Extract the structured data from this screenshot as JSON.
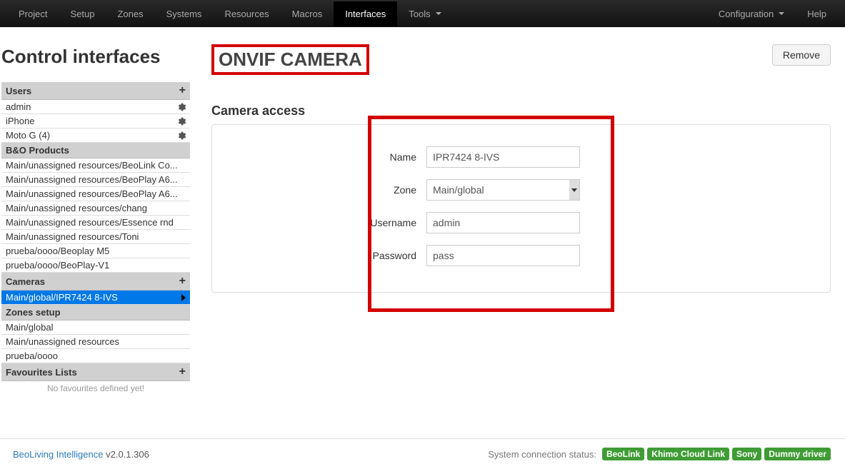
{
  "nav": {
    "left": [
      "Project",
      "Setup",
      "Zones",
      "Systems",
      "Resources",
      "Macros",
      "Interfaces",
      "Tools"
    ],
    "active_index": 6,
    "tools_has_caret": true,
    "right": [
      "Configuration",
      "Help"
    ],
    "config_has_caret": true
  },
  "sidebar": {
    "title": "Control interfaces",
    "sections": {
      "users": {
        "label": "Users",
        "items": [
          {
            "label": "admin",
            "gear": true
          },
          {
            "label": "iPhone",
            "gear": true
          },
          {
            "label": "Moto G (4)",
            "gear": true
          }
        ]
      },
      "products": {
        "label": "B&O Products",
        "items": [
          {
            "label": "Main/unassigned resources/BeoLink Co..."
          },
          {
            "label": "Main/unassigned resources/BeoPlay A6..."
          },
          {
            "label": "Main/unassigned resources/BeoPlay A6..."
          },
          {
            "label": "Main/unassigned resources/chang"
          },
          {
            "label": "Main/unassigned resources/Essence rnd"
          },
          {
            "label": "Main/unassigned resources/Toni"
          },
          {
            "label": "prueba/oooo/Beoplay M5"
          },
          {
            "label": "prueba/oooo/BeoPlay-V1"
          }
        ]
      },
      "cameras": {
        "label": "Cameras",
        "items": [
          {
            "label": "Main/global/IPR7424 8-IVS",
            "active": true
          }
        ]
      },
      "zones": {
        "label": "Zones setup",
        "items": [
          {
            "label": "Main/global"
          },
          {
            "label": "Main/unassigned resources"
          },
          {
            "label": "prueba/oooo"
          }
        ]
      },
      "favourites": {
        "label": "Favourites Lists",
        "note": "No favourites defined yet!"
      }
    }
  },
  "main": {
    "title": "ONVIF CAMERA",
    "remove_label": "Remove",
    "section_title": "Camera access",
    "form": {
      "name": {
        "label": "Name",
        "value": "IPR7424 8-IVS"
      },
      "zone": {
        "label": "Zone",
        "value": "Main/global"
      },
      "username": {
        "label": "Username",
        "value": "admin"
      },
      "password": {
        "label": "Password",
        "value": "pass"
      }
    }
  },
  "footer": {
    "brand": "BeoLiving Intelligence",
    "version": "v2.0.1.306",
    "status_label": "System connection status:",
    "badges": [
      "BeoLink",
      "Khimo Cloud Link",
      "Sony",
      "Dummy driver"
    ]
  }
}
